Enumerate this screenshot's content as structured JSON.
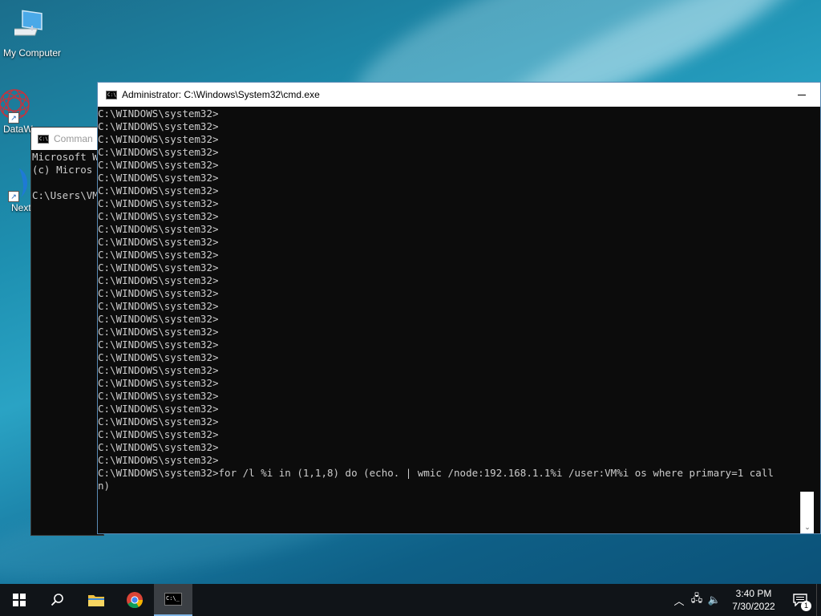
{
  "desktop": {
    "icons": [
      {
        "label": "My Computer",
        "icon": "computer-icon"
      },
      {
        "label": "DataW",
        "icon": "datawrapper-icon"
      },
      {
        "label": "Next",
        "icon": "app-shortcut-icon"
      }
    ]
  },
  "back_window": {
    "title": "Comman",
    "lines": [
      "Microsoft W",
      "(c) Micros",
      "",
      "C:\\Users\\VM"
    ]
  },
  "main_window": {
    "title": "Administrator: C:\\Windows\\System32\\cmd.exe",
    "prompt": "C:\\WINDOWS\\system32>",
    "prompt_repeat_count": 28,
    "command": "for /l %i in (1,1,8) do (echo. | wmic /node:192.168.1.1%i /user:VM%i os where primary=1 call",
    "command_wrap": "n)"
  },
  "taskbar": {
    "items": [
      "start-icon",
      "search-icon",
      "file-explorer-icon",
      "chrome-icon",
      "cmd-icon"
    ],
    "time": "3:40 PM",
    "date": "7/30/2022",
    "notification_count": "1"
  }
}
